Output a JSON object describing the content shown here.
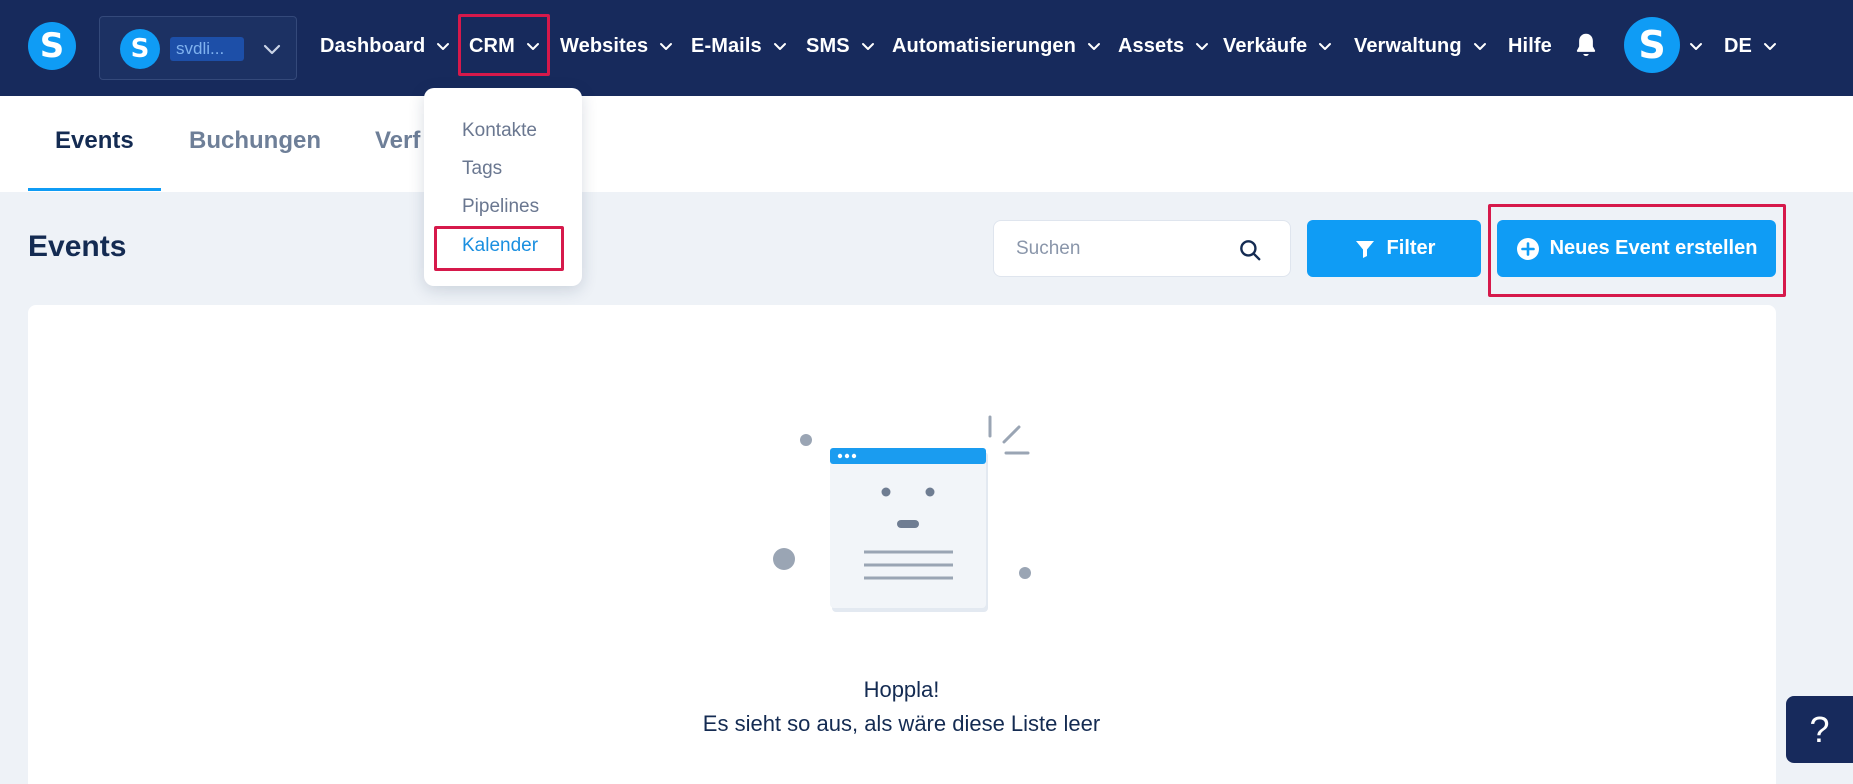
{
  "brand": {
    "logo_letter": "S"
  },
  "workspace": {
    "avatar_letter": "S",
    "name": "svdli..."
  },
  "nav": {
    "dashboard": "Dashboard",
    "crm": "CRM",
    "websites": "Websites",
    "emails": "E-Mails",
    "sms": "SMS",
    "automations": "Automatisierungen",
    "assets": "Assets",
    "sales": "Verkäufe",
    "admin": "Verwaltung",
    "help": "Hilfe",
    "user_letter": "S",
    "language": "DE"
  },
  "crm_menu": {
    "contacts": "Kontakte",
    "tags": "Tags",
    "pipelines": "Pipelines",
    "calendar": "Kalender"
  },
  "tabs": {
    "events": "Events",
    "bookings": "Buchungen",
    "availability": "Verf"
  },
  "page": {
    "title": "Events"
  },
  "search": {
    "placeholder": "Suchen"
  },
  "toolbar": {
    "filter_label": "Filter",
    "new_event_label": "Neues Event erstellen"
  },
  "empty_state": {
    "title": "Hoppla!",
    "subtitle": "Es sieht so aus, als wäre diese Liste leer"
  },
  "support": {
    "help_label": "?"
  },
  "colors": {
    "nav_bg": "#172a5c",
    "accent": "#0f9cf5",
    "highlight": "#d6194b",
    "page_bg": "#eef2f7"
  }
}
